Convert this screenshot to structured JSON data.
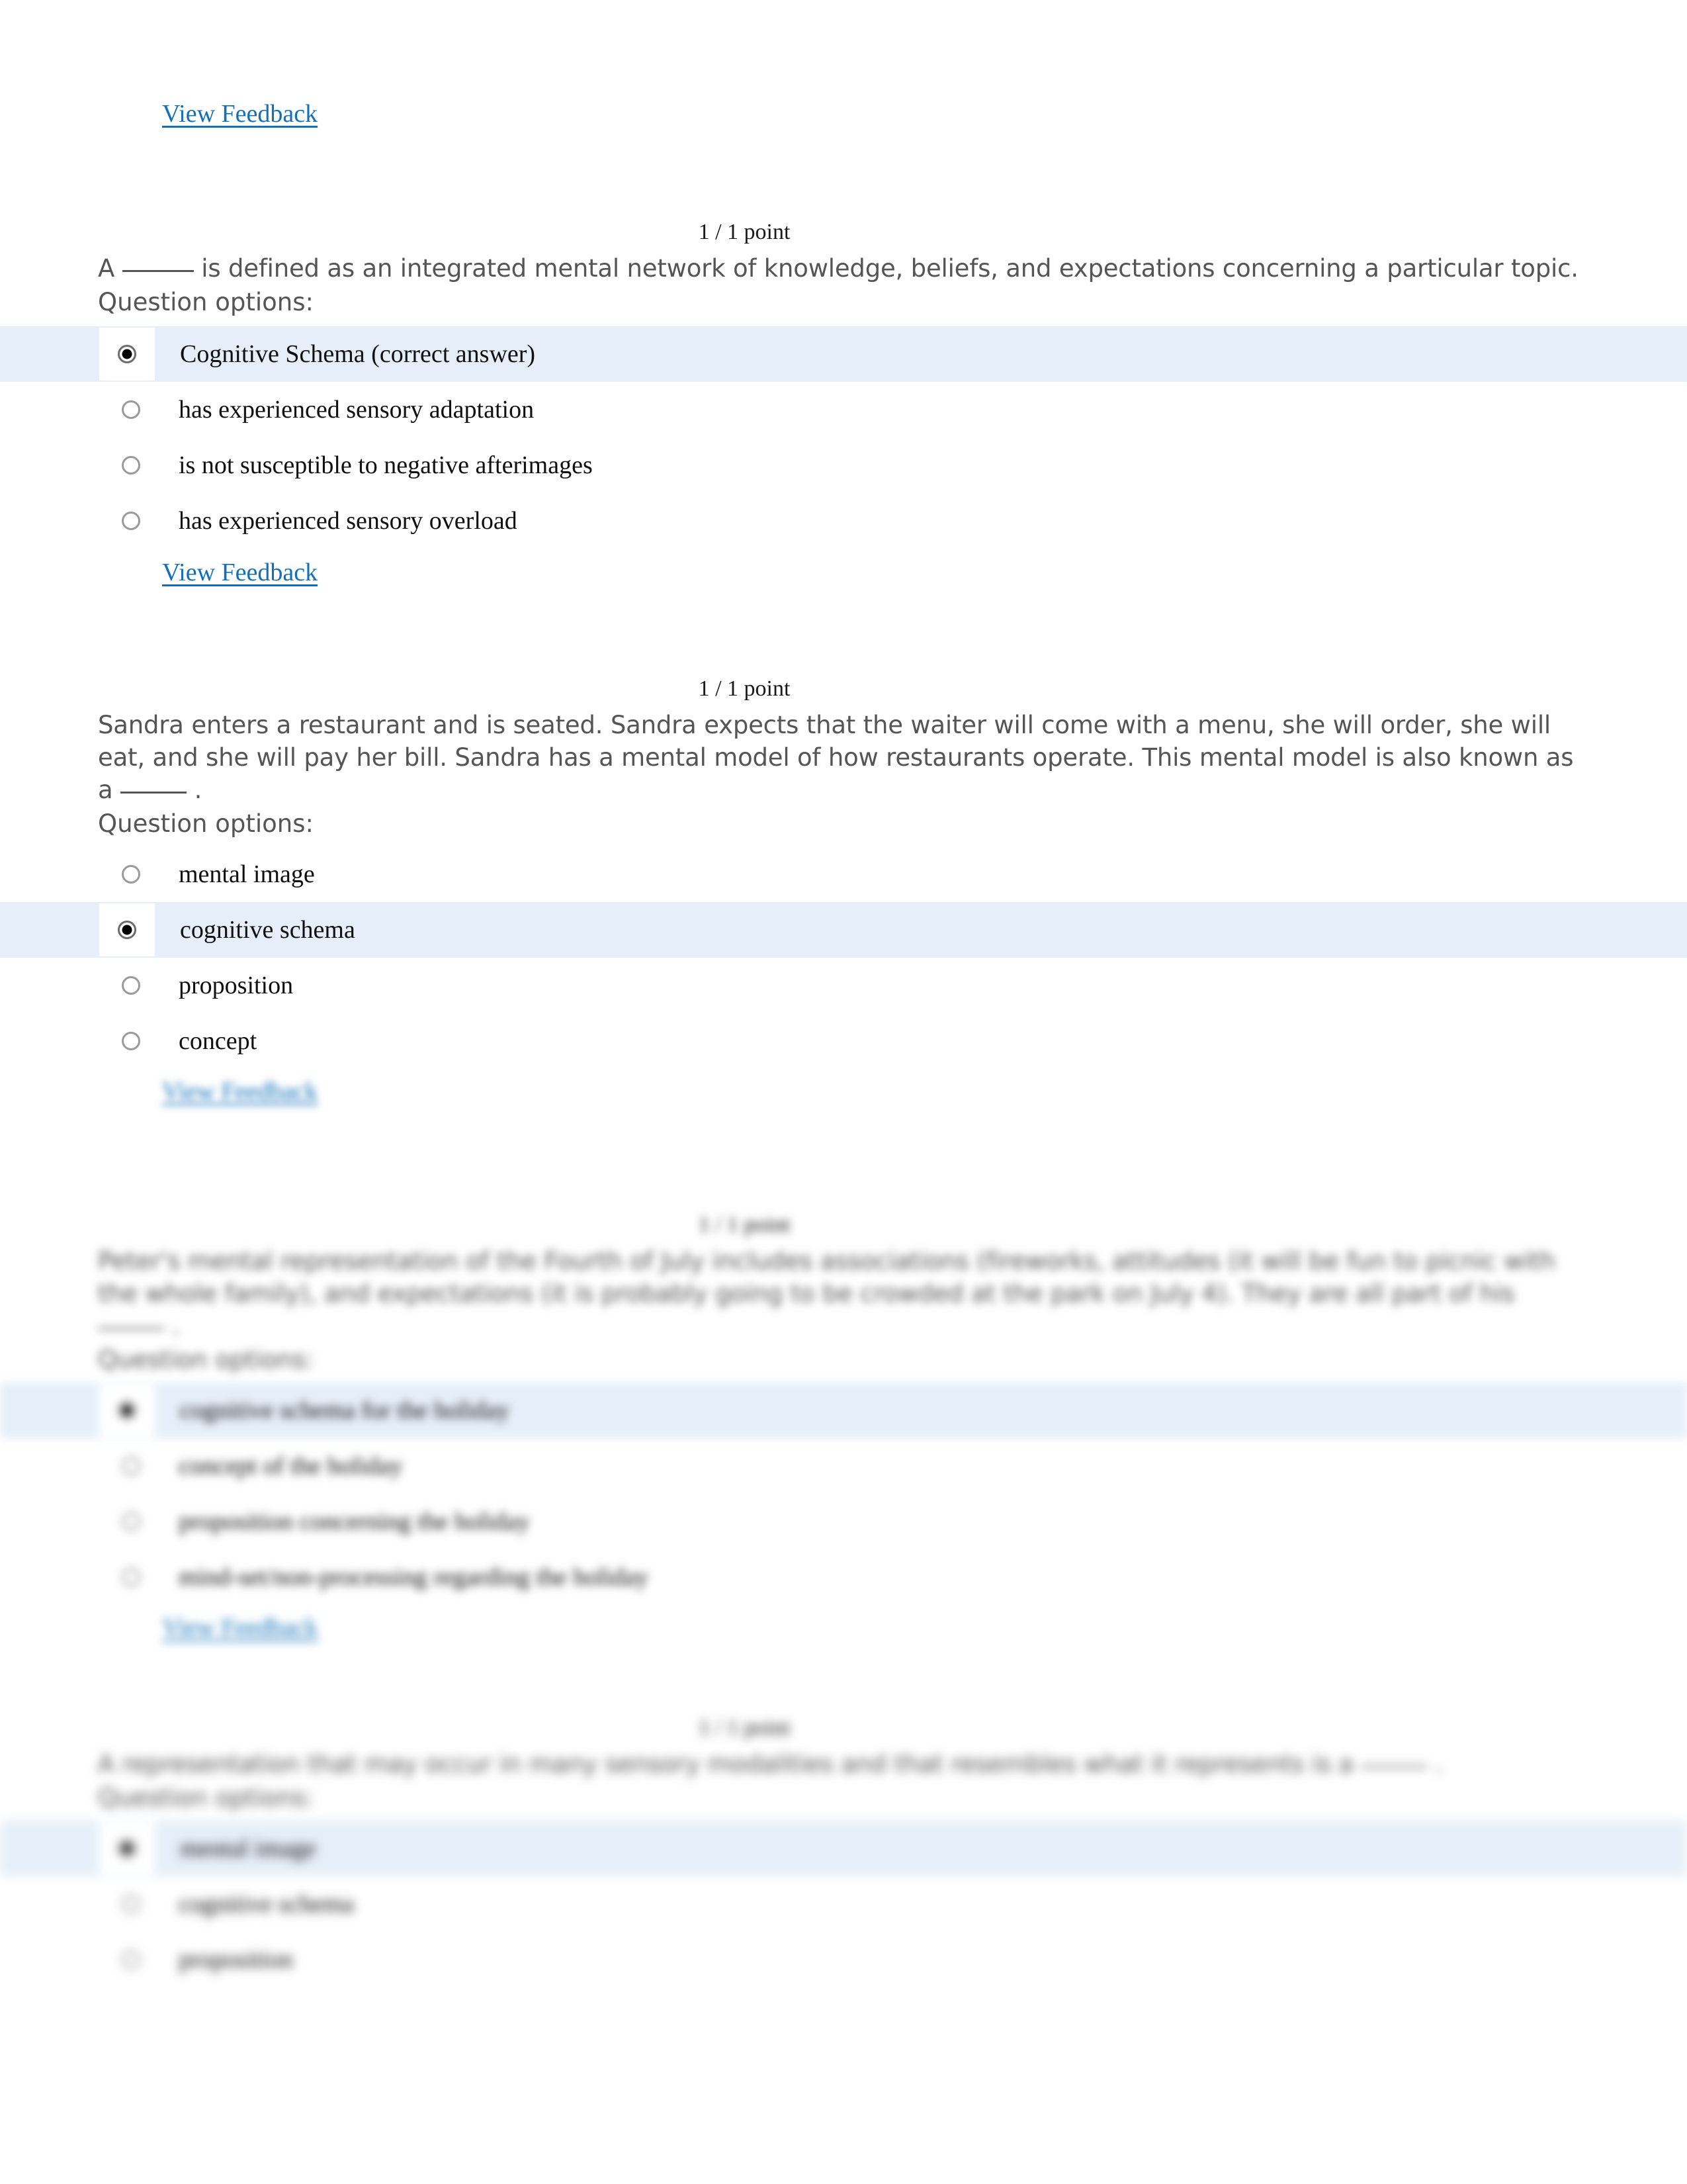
{
  "document": {
    "type": "quiz-results",
    "link_color": "#1370b8",
    "selected_row_color": "#e6eff9",
    "stem_text_color": "#555555"
  },
  "top_feedback_link": "View Feedback",
  "questions": [
    {
      "points": "1 / 1 point",
      "stem_part1": "A",
      "stem_part2": "is defined as an integrated mental network of knowledge, beliefs, and expectations concerning a particular topic.",
      "options_label": "Question options:",
      "options": [
        {
          "label": "Cognitive Schema (correct answer)",
          "selected": true
        },
        {
          "label": "has experienced sensory adaptation",
          "selected": false
        },
        {
          "label": "is not susceptible to negative afterimages",
          "selected": false
        },
        {
          "label": "has experienced sensory overload",
          "selected": false
        }
      ],
      "feedback_link": "View Feedback"
    },
    {
      "points": "1 / 1 point",
      "stem_part1": "Sandra enters a restaurant and is seated. Sandra expects that the waiter will come with a menu, she will order, she will eat, and she will pay her bill. Sandra has a mental model of how restaurants operate. This mental model is also known as a",
      "stem_part2": ".",
      "options_label": "Question options:",
      "options": [
        {
          "label": "mental image",
          "selected": false
        },
        {
          "label": "cognitive schema",
          "selected": true
        },
        {
          "label": "proposition",
          "selected": false
        },
        {
          "label": "concept",
          "selected": false
        }
      ],
      "feedback_link": "View Feedback"
    },
    {
      "points": "1 / 1 point",
      "stem_part1": "Peter's mental representation of the Fourth of July includes associations (fireworks, attitudes (it will be fun to picnic with the whole family), and expectations (it is probably going to be crowded at the park on July 4). They are all part of his",
      "stem_part2": ".",
      "options_label": "Question options:",
      "options": [
        {
          "label": "cognitive schema for the holiday",
          "selected": true
        },
        {
          "label": "concept of the holiday",
          "selected": false
        },
        {
          "label": "proposition concerning the holiday",
          "selected": false
        },
        {
          "label": "mind-set/non-processing regarding the holiday",
          "selected": false
        }
      ],
      "feedback_link": "View Feedback"
    },
    {
      "points": "1 / 1 point",
      "stem_part1": "A representation that may occur in many sensory modalities and that resembles what it represents is a",
      "stem_part2": ".",
      "options_label": "Question options:",
      "options": [
        {
          "label": "mental image",
          "selected": true
        },
        {
          "label": "cognitive schema",
          "selected": false
        },
        {
          "label": "proposition",
          "selected": false
        }
      ],
      "feedback_link": ""
    }
  ]
}
